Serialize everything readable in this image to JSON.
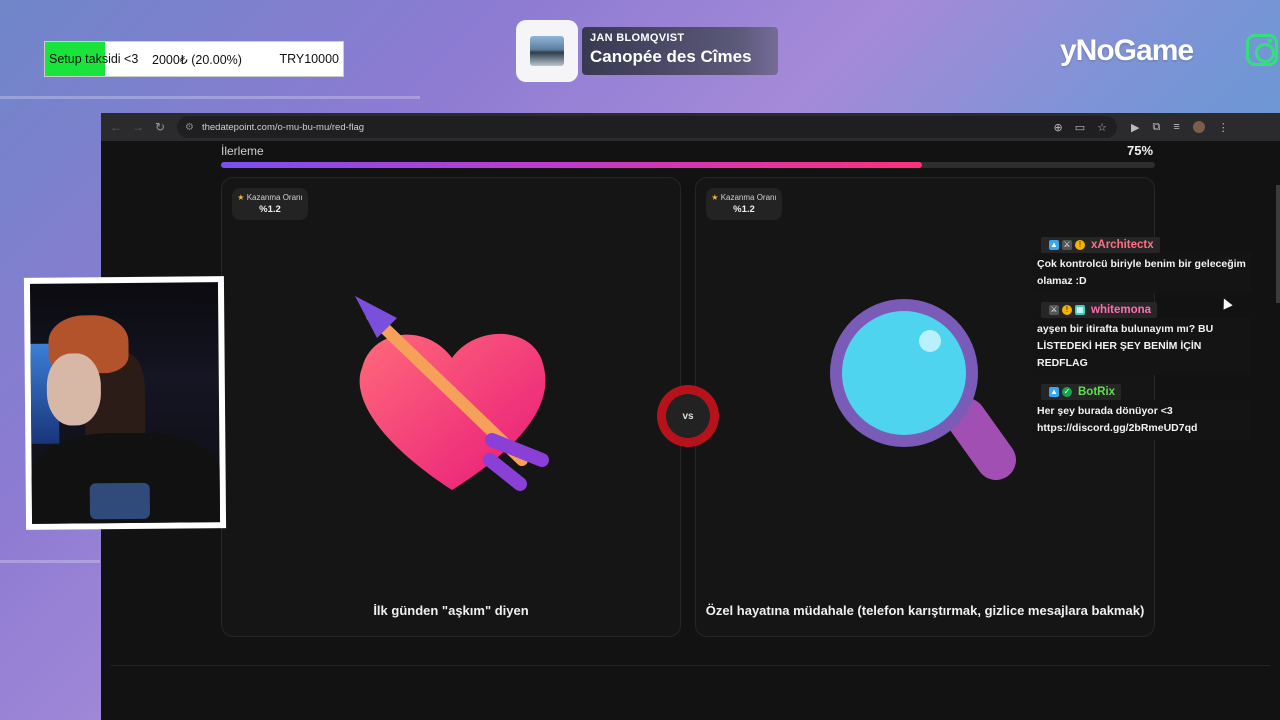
{
  "overlay": {
    "goal": {
      "label": "Setup taksidi <3",
      "progress": "2000₺ (20.00%)",
      "target": "TRY10000",
      "fill_fraction": 0.2,
      "fill_color": "#19e43b"
    },
    "now_playing": {
      "artist": "JAN BLOMQVIST",
      "track": "Canopée des Cîmes"
    },
    "brand": "yNoGame",
    "social_icon": "instagram-icon"
  },
  "browser": {
    "url": "thedatepoint.com/o-mu-bu-mu/red-flag",
    "progress": {
      "label": "İlerleme",
      "percent_text": "75%",
      "value": 0.75
    },
    "vs_label": "vs",
    "cards": [
      {
        "badge_label": "Kazanma Oranı",
        "badge_value": "%1.2",
        "illustration": "heart-with-arrow",
        "title": "İlk günden \"aşkım\" diyen"
      },
      {
        "badge_label": "Kazanma Oranı",
        "badge_value": "%1.2",
        "illustration": "magnifying-glass",
        "title": "Özel hayatına müdahale (telefon karıştırmak, gizlice mesajlara bakmak)"
      }
    ]
  },
  "chat": [
    {
      "name": "xArchitectx",
      "name_color": "#ff6f86",
      "message": "Çok kontrolcü biriyle benim bir geleceğim olamaz :D"
    },
    {
      "name": "whitemona",
      "name_color": "#ff6fb1",
      "message": "ayşen bir itirafta bulunayım mı? BU LİSTEDEKİ HER ŞEY BENİM İÇİN REDFLAG"
    },
    {
      "name": "BotRix",
      "name_color": "#5fe04f",
      "message": "Her şey burada dönüyor <3 https://discord.gg/2bRmeUD7qd"
    }
  ],
  "colors": {
    "accent_gradient_start": "#7b4ff0",
    "accent_gradient_end": "#ff2f7a",
    "vs_ring": "#b5121c"
  }
}
